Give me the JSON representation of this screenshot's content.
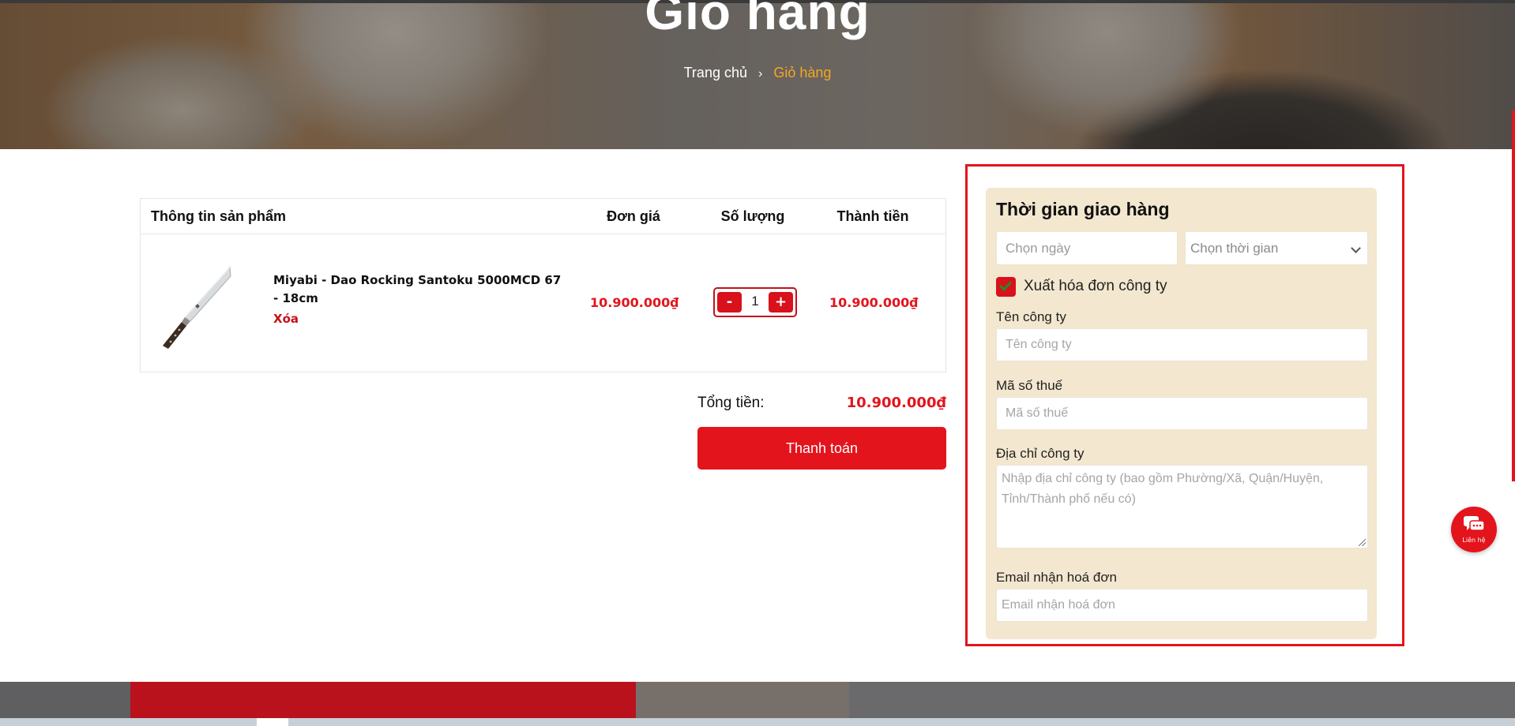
{
  "hero": {
    "title": "Giỏ hàng",
    "breadcrumb": {
      "home": "Trang chủ",
      "separator": "›",
      "current": "Giỏ hàng"
    }
  },
  "cart": {
    "headers": {
      "info": "Thông tin sản phẩm",
      "unit_price": "Đơn giá",
      "quantity": "Số lượng",
      "line_total": "Thành tiền"
    },
    "items": [
      {
        "name": "Miyabi - Dao Rocking Santoku 5000MCD 67 - 18cm",
        "remove_label": "Xóa",
        "unit_price": "10.900.000₫",
        "quantity": "1",
        "minus_label": "-",
        "plus_label": "+",
        "line_total": "10.900.000₫"
      }
    ],
    "summary": {
      "label": "Tổng tiền:",
      "value": "10.900.000₫"
    },
    "checkout_label": "Thanh toán"
  },
  "delivery": {
    "title": "Thời gian giao hàng",
    "date_placeholder": "Chọn ngày",
    "time_selected": "Chọn thời gian",
    "invoice_checkbox": {
      "label": "Xuất hóa đơn công ty",
      "checked": true
    },
    "company_name": {
      "label": "Tên công ty",
      "placeholder": "Tên công ty"
    },
    "tax_code": {
      "label": "Mã số thuế",
      "placeholder": "Mã số thuế"
    },
    "company_address": {
      "label": "Địa chỉ công ty",
      "placeholder": "Nhập địa chỉ công ty (bao gồm Phường/Xã, Quận/Huyện, Tỉnh/Thành phố nếu có)"
    },
    "invoice_email": {
      "label": "Email nhận hoá đơn",
      "placeholder": "Email nhận hoá đơn"
    }
  },
  "contact_fab": {
    "label": "Liên hệ",
    "icon": "chat-bubbles-icon"
  },
  "colors": {
    "accent": "#e3141c",
    "breadcrumb_current": "#f6a623",
    "panel_bg": "#f3e7cf",
    "checkbox_check": "#1f8c2a"
  }
}
